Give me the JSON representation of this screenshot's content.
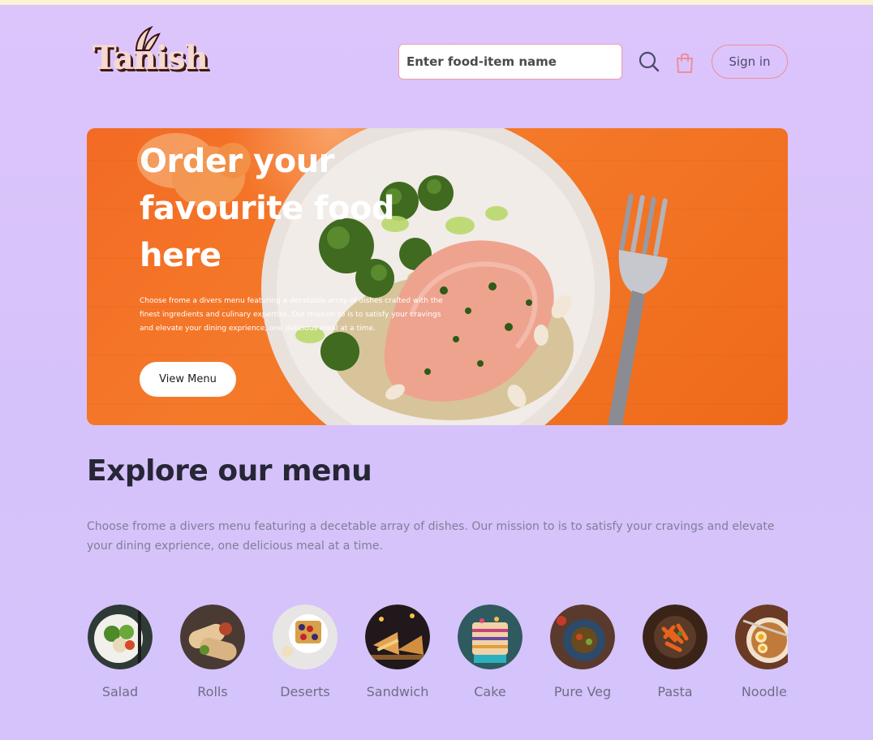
{
  "header": {
    "logo_text": "Tanish",
    "search": {
      "placeholder": "Enter food-item name",
      "value": ""
    },
    "signin_label": "Sign in"
  },
  "hero": {
    "title_line1": "Order your",
    "title_line2": "favourite food",
    "title_line3": "here",
    "description": "Choose frome a divers menu featuring a decetable array of dishes crafted with the finest ingredients and culinary expertise. Our mission to is to satisfy your cravings and elevate your dining exprience, one delicious meal at a time.",
    "button_label": "View Menu"
  },
  "explore": {
    "title": "Explore our menu",
    "description": "Choose frome a divers menu featuring a decetable array of dishes. Our mission to is to satisfy your cravings and elevate your dining exprience, one delicious meal at a time."
  },
  "menu_items": [
    {
      "label": "Salad"
    },
    {
      "label": "Rolls"
    },
    {
      "label": "Deserts"
    },
    {
      "label": "Sandwich"
    },
    {
      "label": "Cake"
    },
    {
      "label": "Pure Veg"
    },
    {
      "label": "Pasta"
    },
    {
      "label": "Noodles"
    }
  ],
  "colors": {
    "background": "#d8c4fb",
    "accent_pink": "#ef8c9c",
    "hero_orange": "#f36a24",
    "heading_dark": "#272637",
    "muted_text": "#807f98"
  },
  "icons": {
    "search": "search-icon",
    "bag": "shopping-bag-icon"
  }
}
